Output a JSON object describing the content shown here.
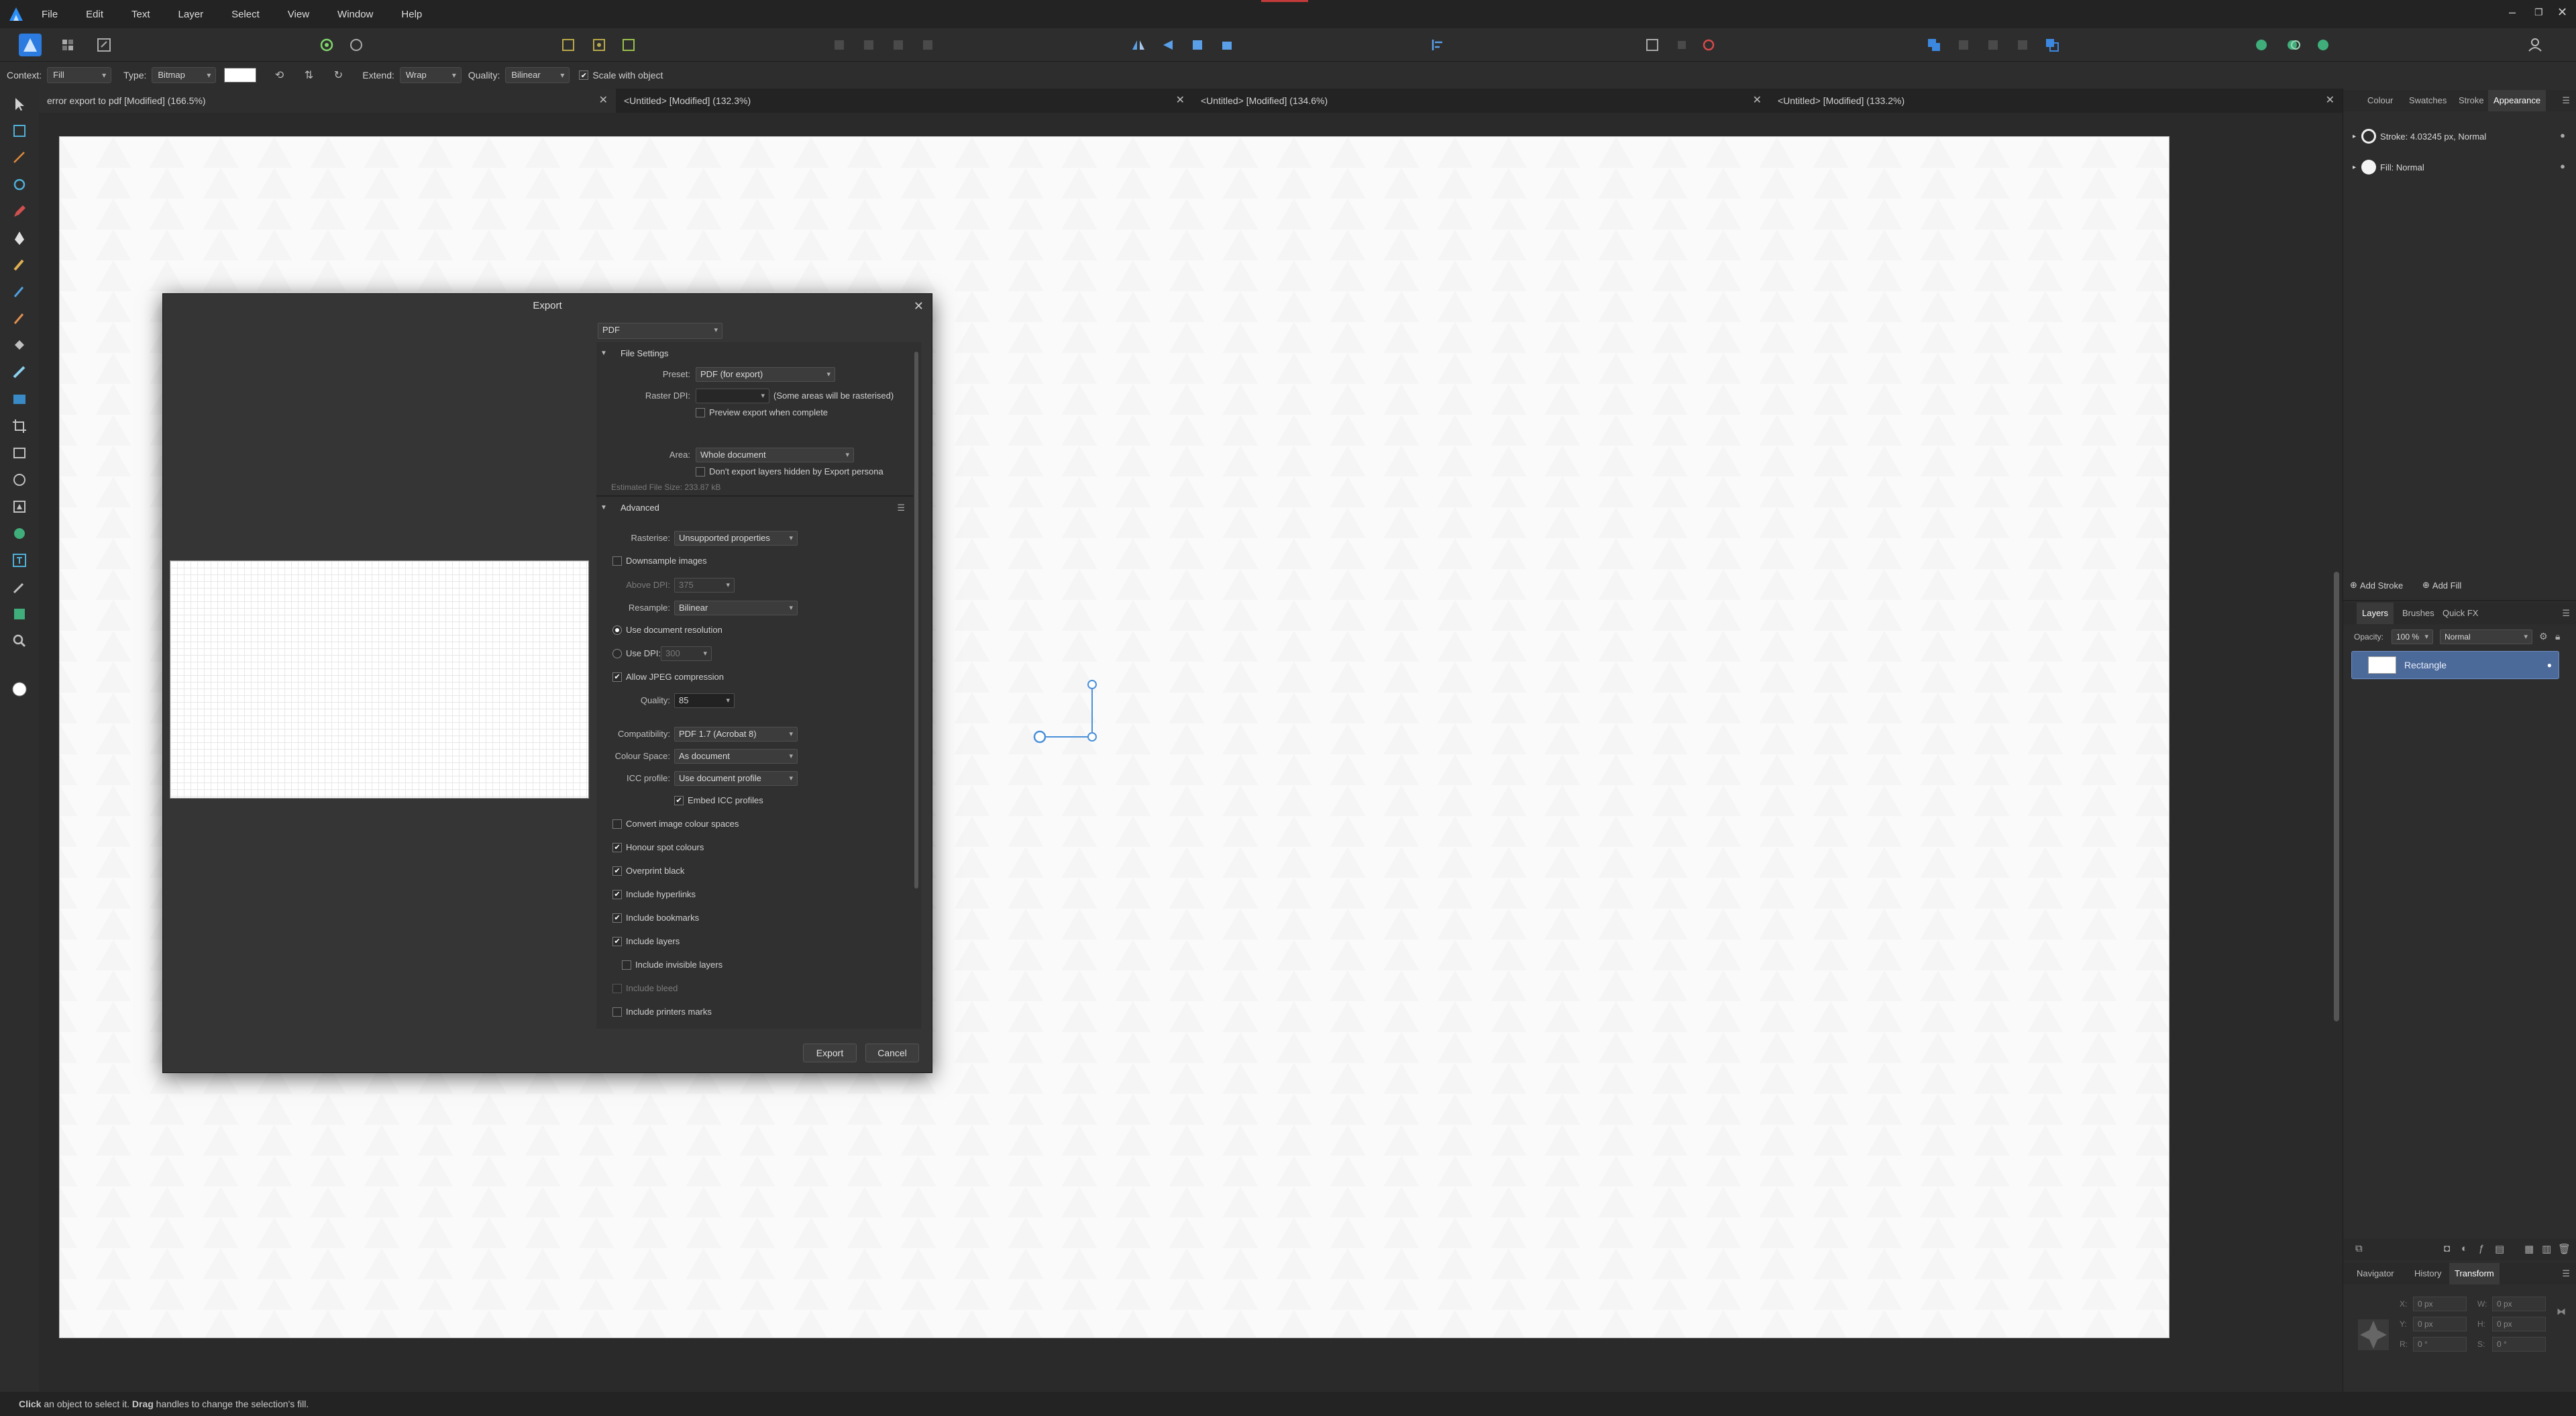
{
  "menubar": {
    "items": [
      "File",
      "Edit",
      "Text",
      "Layer",
      "Select",
      "View",
      "Window",
      "Help"
    ]
  },
  "context": {
    "context_label": "Context:",
    "context_value": "Fill",
    "type_label": "Type:",
    "type_value": "Bitmap",
    "extend_label": "Extend:",
    "extend_value": "Wrap",
    "quality_label": "Quality:",
    "quality_value": "Bilinear",
    "scale_label": "Scale with object"
  },
  "tabs": [
    {
      "title": "error export to pdf [Modified] (166.5%)"
    },
    {
      "title": "<Untitled> [Modified] (132.3%)"
    },
    {
      "title": "<Untitled> [Modified] (134.6%)"
    },
    {
      "title": "<Untitled> [Modified] (133.2%)"
    }
  ],
  "export": {
    "title": "Export",
    "format": "PDF",
    "file_settings": {
      "header": "File Settings",
      "preset_label": "Preset:",
      "preset_value": "PDF (for export)",
      "raster_label": "Raster DPI:",
      "raster_note": "(Some areas will be rasterised)",
      "preview_label": "Preview export when complete",
      "area_label": "Area:",
      "area_value": "Whole document",
      "dont_export_label": "Don't export layers hidden by Export persona",
      "file_size": "Estimated File Size: 233.87 kB"
    },
    "advanced": {
      "header": "Advanced",
      "rasterise_label": "Rasterise:",
      "rasterise_value": "Unsupported properties",
      "downsample_label": "Downsample images",
      "above_dpi_label": "Above DPI:",
      "above_dpi_value": "375",
      "resample_label": "Resample:",
      "resample_value": "Bilinear",
      "use_doc_res_label": "Use document resolution",
      "use_dpi_label": "Use DPI:",
      "use_dpi_value": "300",
      "jpeg_label": "Allow JPEG compression",
      "quality_label": "Quality:",
      "quality_value": "85",
      "compat_label": "Compatibility:",
      "compat_value": "PDF 1.7 (Acrobat 8)",
      "colour_space_label": "Colour Space:",
      "colour_space_value": "As document",
      "icc_label": "ICC profile:",
      "icc_value": "Use document profile",
      "embed_icc_label": "Embed ICC profiles",
      "convert_label": "Convert image colour spaces",
      "honour_label": "Honour spot colours",
      "overprint_label": "Overprint black",
      "hyperlinks_label": "Include hyperlinks",
      "bookmarks_label": "Include bookmarks",
      "layers_label": "Include layers",
      "invisible_label": "Include invisible layers",
      "bleed_label": "Include bleed",
      "printers_label": "Include printers marks"
    },
    "export_button": "Export",
    "cancel_button": "Cancel"
  },
  "right_panel": {
    "top_tabs": [
      "Colour",
      "Swatches",
      "Stroke",
      "Appearance"
    ],
    "stroke_label": "Stroke: 4.03245 px,  Normal",
    "fill_label": "Fill:  Normal",
    "add_stroke": "Add Stroke",
    "add_fill": "Add Fill",
    "layer_tabs": [
      "Layers",
      "Brushes",
      "Quick FX"
    ],
    "opacity_label": "Opacity:",
    "opacity_value": "100 %",
    "blend_value": "Normal",
    "layer_name": "Rectangle",
    "bottom_tabs": [
      "Navigator",
      "History",
      "Transform"
    ],
    "x_label": "X:",
    "x_value": "0 px",
    "y_label": "Y:",
    "y_value": "0 px",
    "w_label": "W:",
    "w_value": "0 px",
    "h_label": "H:",
    "h_value": "0 px",
    "r_label": "R:",
    "r_value": "0 °",
    "s_label": "S:",
    "s_value": "0 °"
  },
  "status": {
    "click": "Click",
    "text1": " an object to select it. ",
    "drag": "Drag",
    "text2": " handles to change the selection's fill."
  },
  "colors": {
    "accent": "#4c6a99",
    "selection_handle": "#4a90d9"
  }
}
